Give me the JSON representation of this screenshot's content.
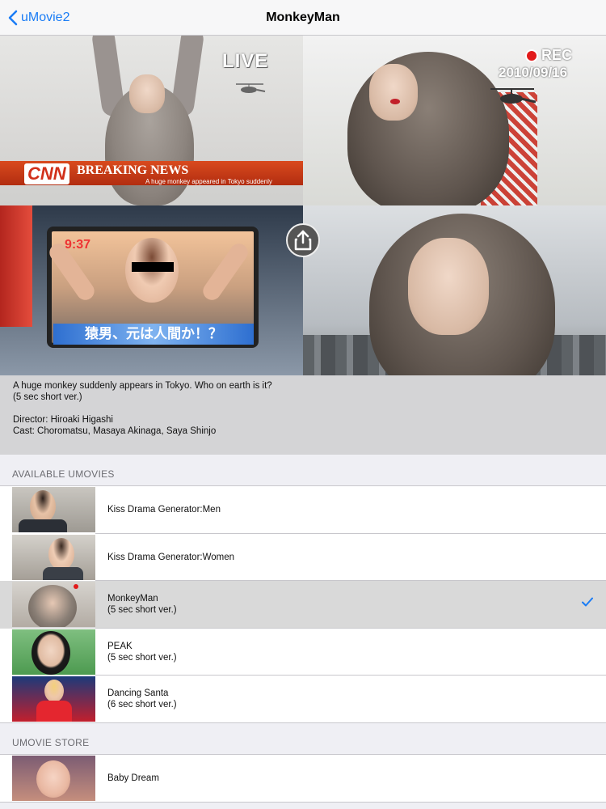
{
  "nav": {
    "back_label": "uMovie2",
    "title": "MonkeyMan"
  },
  "preview": {
    "live_label": "LIVE",
    "breaking_label": "BREAKING NEWS",
    "news_logo": "CNN",
    "news_subtitle": "A huge monkey appeared in Tokyo suddenly",
    "rec_label": "REC",
    "rec_date": "2010/09/16",
    "clock": "9:37",
    "jp_caption": "猿男、元は人間か！？"
  },
  "description": {
    "summary": "A huge monkey suddenly appears in Tokyo. Who on earth is it?",
    "version": "(5 sec short ver.)",
    "director": "Director: Hiroaki Higashi",
    "cast": "Cast: Choromatsu, Masaya Akinaga, Saya Shinjo"
  },
  "available": {
    "header": "AVAILABLE UMOVIES",
    "items": [
      {
        "title": "Kiss Drama Generator:Men",
        "subtitle": ""
      },
      {
        "title": "Kiss Drama Generator:Women",
        "subtitle": ""
      },
      {
        "title": "MonkeyMan",
        "subtitle": "(5 sec short ver.)"
      },
      {
        "title": "PEAK",
        "subtitle": "(5 sec short ver.)"
      },
      {
        "title": "Dancing Santa",
        "subtitle": "(6 sec short ver.)"
      }
    ]
  },
  "store": {
    "header": "UMOVIE STORE",
    "items": [
      {
        "title": "Baby Dream"
      }
    ]
  },
  "colors": {
    "accent": "#1a7cf5",
    "selected_row": "#d9d9d9",
    "rec_red": "#e21b1b"
  }
}
